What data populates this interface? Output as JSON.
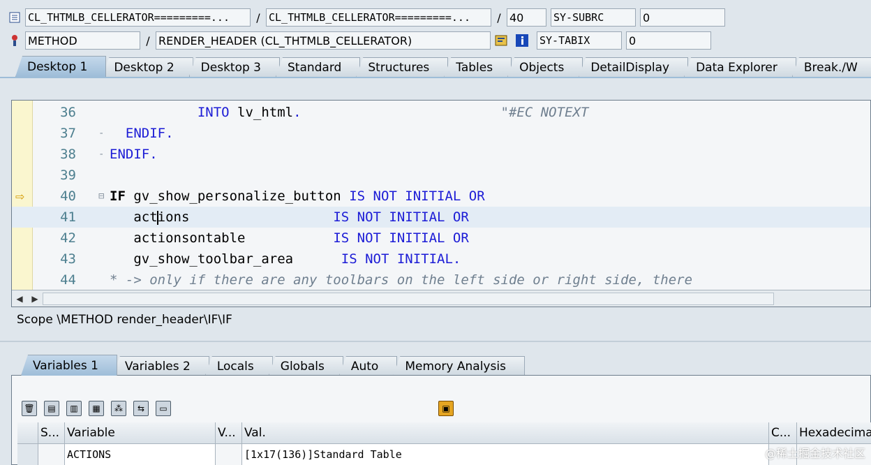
{
  "header": {
    "row1": {
      "program": "CL_THTMLB_CELLERATOR=========...",
      "include": "CL_THTMLB_CELLERATOR=========...",
      "line": "40",
      "sy_label": "SY-SUBRC",
      "sy_value": "0"
    },
    "row2": {
      "event_type": "METHOD",
      "event": "RENDER_HEADER (CL_THTMLB_CELLERATOR)",
      "sy_label": "SY-TABIX",
      "sy_value": "0"
    },
    "separator": "/"
  },
  "main_tabs": [
    {
      "label": "Desktop 1",
      "active": true
    },
    {
      "label": "Desktop 2"
    },
    {
      "label": "Desktop 3"
    },
    {
      "label": "Standard"
    },
    {
      "label": "Structures"
    },
    {
      "label": "Tables"
    },
    {
      "label": "Objects"
    },
    {
      "label": "DetailDisplay"
    },
    {
      "label": "Data Explorer"
    },
    {
      "label": "Break./W"
    }
  ],
  "code": {
    "lines": [
      {
        "num": "36",
        "fold": "",
        "parts": [
          {
            "t": "           ",
            "c": "id"
          },
          {
            "t": "INTO",
            "c": "kw"
          },
          {
            "t": " lv_html",
            "c": "id"
          },
          {
            "t": ".",
            "c": "kw"
          },
          {
            "t": "                         \"#EC NOTEXT",
            "c": "cm"
          }
        ]
      },
      {
        "num": "37",
        "fold": "-",
        "parts": [
          {
            "t": "  ",
            "c": "id"
          },
          {
            "t": "ENDIF.",
            "c": "kw"
          }
        ]
      },
      {
        "num": "38",
        "fold": "-",
        "parts": [
          {
            "t": "",
            "c": "id"
          },
          {
            "t": "ENDIF.",
            "c": "kw"
          }
        ]
      },
      {
        "num": "39",
        "fold": "",
        "parts": []
      },
      {
        "num": "40",
        "fold": "⊟",
        "parts": [
          {
            "t": "IF",
            "c": "kwb"
          },
          {
            "t": " gv_show_personalize_button ",
            "c": "id"
          },
          {
            "t": "IS NOT INITIAL OR",
            "c": "kw"
          }
        ]
      },
      {
        "num": "41",
        "fold": "",
        "parts": [
          {
            "t": "   act",
            "c": "id"
          },
          {
            "t": "CARET",
            "c": "caret"
          },
          {
            "t": "ions",
            "c": "id"
          },
          {
            "t": "                  ",
            "c": "id"
          },
          {
            "t": "IS NOT INITIAL OR",
            "c": "kw"
          }
        ]
      },
      {
        "num": "42",
        "fold": "",
        "parts": [
          {
            "t": "   actionsontable",
            "c": "id"
          },
          {
            "t": "           ",
            "c": "id"
          },
          {
            "t": "IS NOT INITIAL OR",
            "c": "kw"
          }
        ]
      },
      {
        "num": "43",
        "fold": "",
        "parts": [
          {
            "t": "   gv_show_toolbar_area",
            "c": "id"
          },
          {
            "t": "      ",
            "c": "id"
          },
          {
            "t": "IS NOT INITIAL.",
            "c": "kw"
          }
        ]
      },
      {
        "num": "44",
        "fold": "",
        "parts": [
          {
            "t": "* -> only if there are any toolbars on the left side or right side, there",
            "c": "cm"
          }
        ]
      }
    ]
  },
  "scope": "Scope \\METHOD render_header\\IF\\IF",
  "var_tabs": [
    {
      "label": "Variables 1",
      "active": true
    },
    {
      "label": "Variables 2"
    },
    {
      "label": "Locals"
    },
    {
      "label": "Globals"
    },
    {
      "label": "Auto"
    },
    {
      "label": "Memory Analysis"
    }
  ],
  "toolbar_icons": [
    "delete-icon",
    "insert-icon",
    "append-icon",
    "remove-all-icon",
    "hierarchy-icon",
    "transfer-icon",
    "import-icon"
  ],
  "var_table": {
    "headers": [
      "S...",
      "Variable",
      "V...",
      "Val.",
      "C...",
      "Hexadecimal"
    ],
    "rows": [
      [
        "",
        "ACTIONS",
        "",
        "[1x17(136)]Standard Table",
        "",
        ""
      ]
    ]
  },
  "watermark": "@稀土掘金技术社区"
}
